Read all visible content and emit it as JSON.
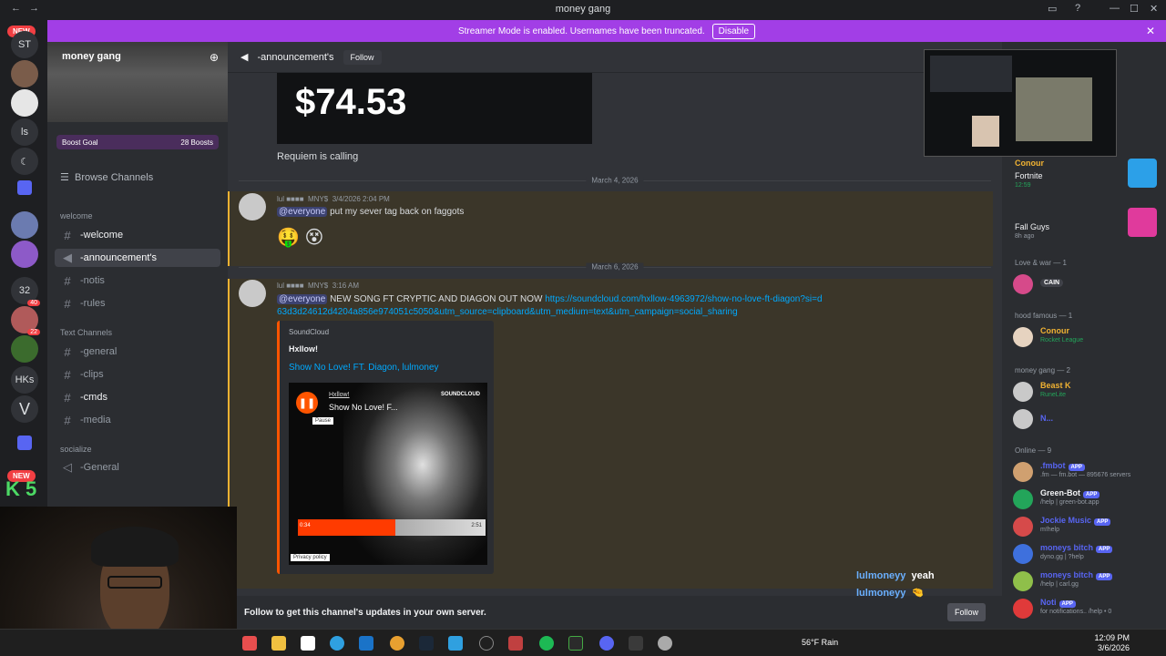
{
  "window": {
    "title": "money gang"
  },
  "banner": {
    "text": "Streamer Mode is enabled. Usernames have been truncated.",
    "button": "Disable"
  },
  "servers": [
    {
      "label": "NEW",
      "type": "badge"
    },
    {
      "label": "ST"
    },
    {
      "label": ""
    },
    {
      "label": ""
    },
    {
      "label": "ls"
    },
    {
      "label": ""
    },
    {
      "label": ""
    },
    {
      "label": ""
    },
    {
      "label": ""
    },
    {
      "label": "32",
      "badge": "40"
    },
    {
      "label": "",
      "badge": "22"
    },
    {
      "label": ""
    },
    {
      "label": "HKs"
    },
    {
      "label": ""
    },
    {
      "label": ""
    },
    {
      "label": "NEW",
      "type": "badge"
    }
  ],
  "server": {
    "name": "money gang",
    "boost_goal": "Boost Goal",
    "boosts": "28 Boosts",
    "browse": "Browse Channels"
  },
  "channel_list": {
    "cat_welcome": "welcome",
    "welcome": "-welcome",
    "announcements": "-announcement's",
    "notis": "-notis",
    "rules": "-rules",
    "cat_text": "Text Channels",
    "general": "-general",
    "clips": "-clips",
    "cmds": "-cmds",
    "media": "-media",
    "cat_socialize": "socialize",
    "General": "-General"
  },
  "channel": {
    "name": "-announcement's",
    "follow": "Follow"
  },
  "messages": {
    "price": "$74.53",
    "requiem": "Requiem is calling",
    "date1": "March 4, 2026",
    "m1_role": "MNY$",
    "m1_time": "3/4/2026 2:04 PM",
    "m1_mention": "@everyone",
    "m1_text": " put my sever tag back on faggots",
    "m1_emojis": "🤑 😵",
    "date2": "March 6, 2026",
    "m2_role": "MNY$",
    "m2_time": "3:16 AM",
    "m2_mention": "@everyone",
    "m2_text": " NEW SONG FT CRYPTIC AND DIAGON OUT NOW ",
    "m2_link": "https://soundcloud.com/hxllow-4963972/show-no-love-ft-diagon?si=d63d3d24612d4204a856e974051c5050&utm_source=clipboard&utm_medium=text&utm_campaign=social_sharing"
  },
  "embed": {
    "site": "SoundCloud",
    "author": "Hxllow!",
    "title": "Show No Love! FT. Diagon, lulmoney",
    "player_artist": "Hxllow!",
    "player_title": "Show No Love! F...",
    "pause_tip": "Pause",
    "brand": "SOUNDCLOUD",
    "privacy": "Privacy policy",
    "t_start": "0:34",
    "t_end": "2:51"
  },
  "footer": {
    "text": "Follow to get this channel's updates in your own server.",
    "button": "Follow"
  },
  "overlay_chat": [
    {
      "user": "lulmoneyy",
      "text": "yeah"
    },
    {
      "user": "lulmoneyy",
      "text": "🤏"
    }
  ],
  "members": {
    "activity": [
      {
        "name": "Conour",
        "status": "Fortnite",
        "sub": "12:59"
      },
      {
        "name": "",
        "status": "Fall Guys",
        "sub": "8h ago"
      }
    ],
    "g_love": "Love & war — 1",
    "love_member": "CAIN",
    "g_hood": "hood famous — 1",
    "hood_member": {
      "name": "Conour",
      "status": "Rocket League"
    },
    "g_money": "money gang — 2",
    "money_members": [
      {
        "name": "Beast K",
        "status": "RuneLite"
      },
      {
        "name": "N...",
        "status": ""
      }
    ],
    "g_online": "Online — 9",
    "online": [
      {
        "name": ".fmbot",
        "app": "APP",
        "status": ".fm — fm.bot — 895676 servers"
      },
      {
        "name": "Green-Bot",
        "app": "APP",
        "status": "/help | green-bot.app"
      },
      {
        "name": "Jockie Music",
        "app": "APP",
        "status": "m!help"
      },
      {
        "name": "moneys bitch",
        "app": "APP",
        "status": "dyno.gg | ?help"
      },
      {
        "name": "moneys bitch",
        "app": "APP",
        "status": "/help | carl.gg"
      },
      {
        "name": "Noti",
        "app": "APP",
        "status": "for notifications.. /help • 0"
      }
    ]
  },
  "stream_label": "K 5",
  "taskbar": {
    "weather": "56°F Rain",
    "time": "12:09 PM",
    "date": "3/6/2026"
  },
  "colors": {
    "accent": "#5865f2",
    "banner": "#a23ee6",
    "soundcloud": "#ff5500",
    "mention": "#3c4270",
    "highlight": "#f0b232"
  }
}
